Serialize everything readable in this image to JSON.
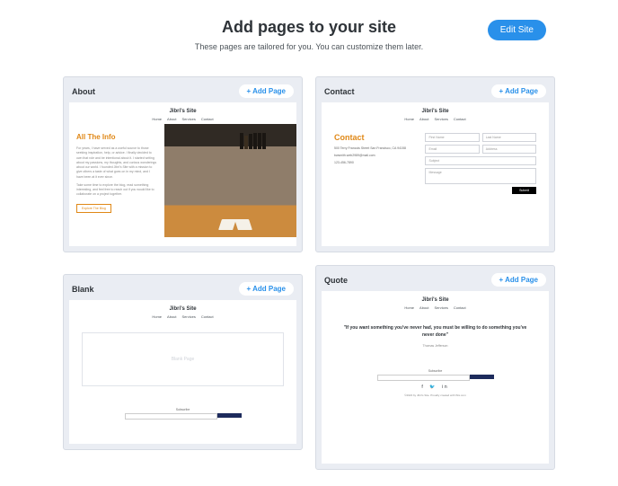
{
  "header": {
    "title": "Add pages to your site",
    "subtitle": "These pages are tailored for you. You can customize them later.",
    "edit_btn": "Edit Site"
  },
  "add_page_label": "+ Add Page",
  "site_name": "Jibri's Site",
  "nav": [
    "Home",
    "About",
    "Services",
    "Contact"
  ],
  "cards": {
    "about": {
      "title": "About",
      "heading": "All The Info",
      "p1": "For years, I have served as a useful source to those seeking inspiration, help, or advice. I finally decided to own that role and be intentional about it. I started writing about my passions, my thoughts, and curious wonderings about our world. I founded Jibri's Site with a mission to give others a taste of what goes on in my mind, and I have been at it ever since.",
      "p2": "Take some time to explore the blog, read something interesting, and feel free to reach out if you would like to collaborate on a project together.",
      "btn": "Explore The Blog"
    },
    "contact": {
      "title": "Contact",
      "heading": "Contact",
      "address": "500 Terry Francois Street San Francisco, CA 94158",
      "email": "bwsmith.web2989@mail.com",
      "phone": "123-456-7890",
      "fields": {
        "first": "First Name",
        "last": "Last Name",
        "em": "Email",
        "addr": "Address",
        "subj": "Subject",
        "msg": "Message",
        "submit": "Submit"
      }
    },
    "quote": {
      "title": "Quote",
      "text": "\"If you want something you've never had, you must be willing to do something you've never done\"",
      "author": "Thomas Jefferson",
      "signup": "Subscribe",
      "footer": "©2023 by Jibri's Site. Proudly created with Wix.com"
    },
    "blank": {
      "title": "Blank",
      "placeholder": "Blank Page",
      "signup": "Subscribe"
    }
  }
}
